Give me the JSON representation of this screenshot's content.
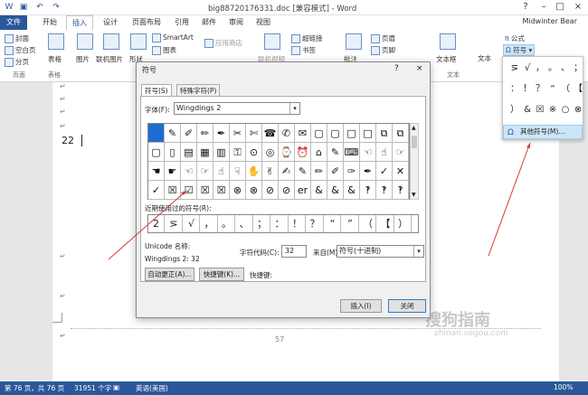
{
  "window": {
    "title": "big88720176331.doc [兼容模式] - Word",
    "user": "Midwinter Bear"
  },
  "tabs": [
    "文件",
    "开始",
    "插入",
    "设计",
    "页面布局",
    "引用",
    "邮件",
    "审阅",
    "视图"
  ],
  "ribbon": {
    "cover": "封面",
    "blank": "空白页",
    "pagebreak": "分页",
    "group_pages": "页面",
    "table": "表格",
    "group_tables": "表格",
    "picture": "图片",
    "online_picture": "联机图片",
    "shapes": "形状",
    "smartart": "SmartArt",
    "chart": "图表",
    "appstore": "应用商店",
    "online_video": "联机视频",
    "hyperlink": "超链接",
    "bookmark": "书签",
    "comment": "批注",
    "header": "页眉",
    "footer": "页脚",
    "textbox": "文本框",
    "wordart": "文本",
    "equation": "公式",
    "symbol": "符号",
    "group_text": "文本"
  },
  "document": {
    "line_text": "22",
    "page_number": "57"
  },
  "status": {
    "page": "第 76 页，共 76 页",
    "words": "31951 个字",
    "lang": "英语(美国)",
    "zoom": "100%"
  },
  "dialog": {
    "title": "符号",
    "help": "?",
    "close": "×",
    "tab_symbols": "符号(S)",
    "tab_special": "特殊字符(P)",
    "font_label": "字体(F):",
    "font_value": "Wingdings 2",
    "recent_label": "近期使用过的符号(R):",
    "unicode_name_label": "Unicode 名称:",
    "unicode_name_value": "Wingdings 2: 32",
    "charcode_label": "字符代码(C):",
    "charcode_value": "32",
    "from_label": "来自(M):",
    "from_value": "符号(十进制)",
    "autocorrect": "自动更正(A)...",
    "shortcut_btn": "快捷键(K)...",
    "shortcut_label": "快捷键:",
    "insert": "插入(I)",
    "cancel": "关闭",
    "grid": [
      [
        "",
        "✎",
        "✐",
        "✏",
        "✒",
        "✂",
        "✄",
        "☎",
        "✆",
        "✉",
        "▢",
        "▢",
        "□",
        "□",
        "⧉",
        "⧉"
      ],
      [
        "▢",
        "▯",
        "▤",
        "▦",
        "▥",
        "⚿",
        "⊙",
        "◎",
        "⌚",
        "⏰",
        "⌂",
        "✎",
        "⌨",
        "☜",
        "☝",
        "☞"
      ],
      [
        "☚",
        "☛",
        "☜",
        "☞",
        "☝",
        "☟",
        "✋",
        "✌",
        "✍",
        "✎",
        "✏",
        "✐",
        "✑",
        "✒",
        "✓",
        "✕"
      ],
      [
        "✓",
        "☒",
        "☑",
        "☒",
        "☒",
        "⊗",
        "⊗",
        "⊘",
        "⊘",
        "er",
        "&",
        "&",
        "&",
        "‽",
        "‽",
        "‽"
      ]
    ],
    "recent": [
      "2",
      "⋝",
      "√",
      "，",
      "。",
      "、",
      "；",
      "：",
      "！",
      "？",
      "“",
      "”",
      "（",
      "【",
      "）"
    ]
  },
  "dropdown": {
    "symbols": [
      "⋝",
      "√",
      "，",
      "。",
      "、",
      "；",
      "：",
      "！",
      "？",
      "“",
      "（",
      "【",
      "）",
      "&",
      "☒",
      "※",
      "○",
      "⊗"
    ],
    "more": "其他符号(M)..."
  },
  "watermark": {
    "cn": "搜狗指南",
    "en": "zhinan.sogou.com"
  },
  "colors": {
    "accent": "#2b579a",
    "selected": "#1f6bd1"
  }
}
